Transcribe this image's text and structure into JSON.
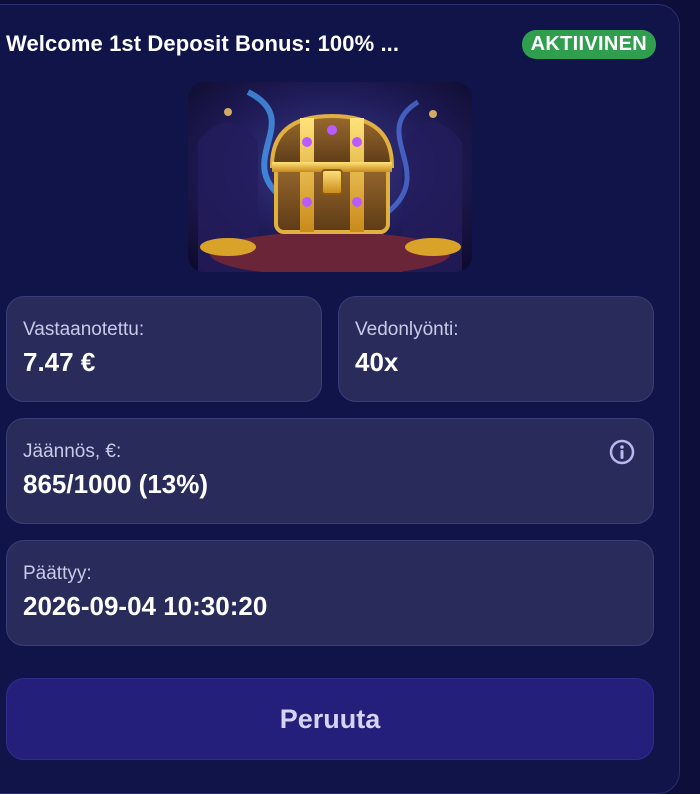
{
  "bonus": {
    "title": "Welcome 1st Deposit Bonus: 100% ...",
    "status": "AKTIIVINEN",
    "image_alt": "treasure-chest-illustration"
  },
  "stats": {
    "received_label": "Vastaanotettu:",
    "received_value": "7.47 €",
    "wagering_label": "Vedonlyönti:",
    "wagering_value": "40x",
    "remaining_label": "Jäännös, €:",
    "remaining_value": "865/1000 (13%)",
    "expires_label": "Päättyy:",
    "expires_value": "2026-09-04 10:30:20"
  },
  "actions": {
    "cancel_label": "Peruuta"
  },
  "icons": {
    "info": "info-icon"
  },
  "colors": {
    "status_green": "#2f9e4f",
    "card_bg": "#292c5b",
    "button_bg": "#241f7a"
  }
}
